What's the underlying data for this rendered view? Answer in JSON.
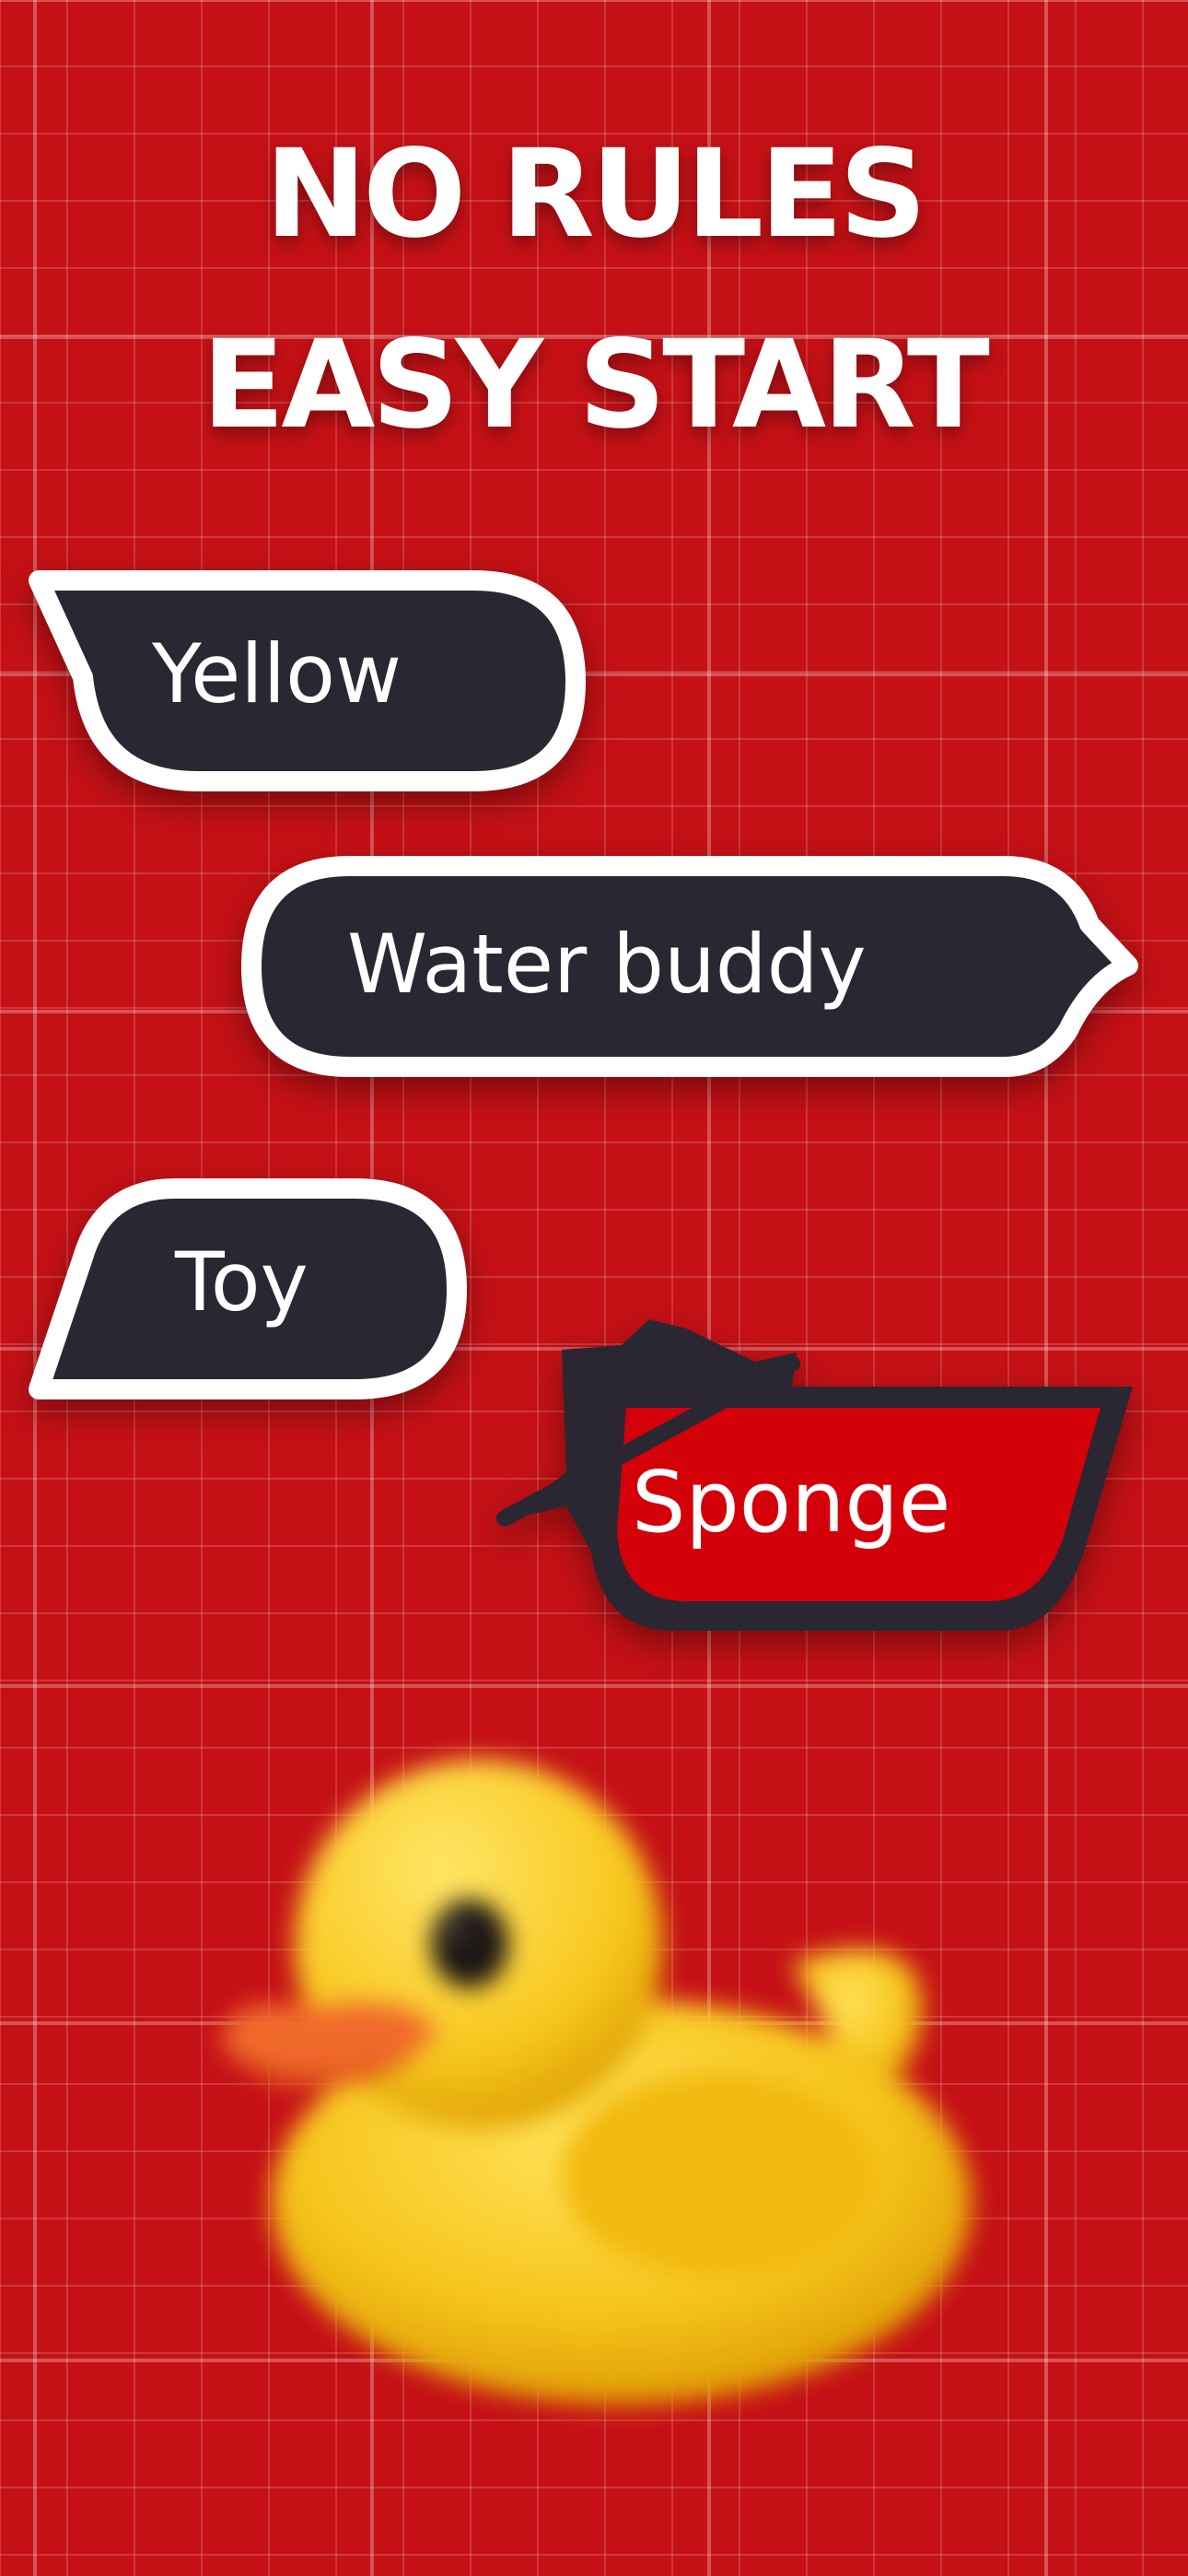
{
  "headline": {
    "line1": "NO RULES",
    "line2": "EASY START"
  },
  "bubbles": {
    "yellow": "Yellow",
    "water_buddy": "Water buddy",
    "toy": "Toy",
    "sponge": "Sponge"
  },
  "colors": {
    "background": "#c51116",
    "bubble_dark": "#2a2733",
    "bubble_highlight": "#d40009",
    "outline": "#ffffff",
    "duck_yellow": "#f7c81f",
    "duck_beak": "#f06a2b"
  },
  "images": {
    "duck": "rubber-duck"
  }
}
